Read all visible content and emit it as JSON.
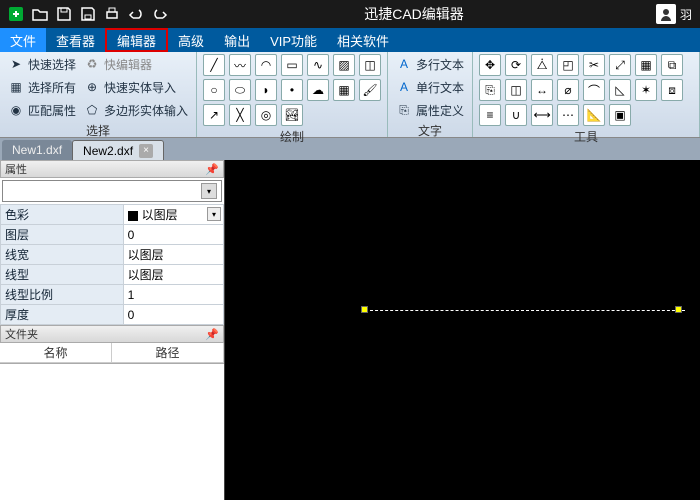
{
  "app_title": "迅捷CAD编辑器",
  "titlebar_right_user": "羽",
  "menu": {
    "file": "文件",
    "viewer": "查看器",
    "editor": "编辑器",
    "advanced": "高级",
    "output": "输出",
    "vip": "VIP功能",
    "related": "相关软件"
  },
  "ribbon": {
    "select": {
      "label": "选择",
      "quick_select": "快速选择",
      "quick_editor": "快编辑器",
      "select_all": "选择所有",
      "quick_entity_import": "快速实体导入",
      "match_props": "匹配属性",
      "polygon_entity_input": "多边形实体输入"
    },
    "draw": {
      "label": "绘制"
    },
    "text": {
      "label": "文字",
      "multi_text": "多行文本",
      "single_text": "单行文本",
      "attr_def": "属性定义"
    },
    "tools": {
      "label": "工具"
    }
  },
  "tabs": [
    {
      "name": "New1.dxf",
      "active": false
    },
    {
      "name": "New2.dxf",
      "active": true
    }
  ],
  "props_panel": {
    "header": "属性",
    "color_label": "色彩",
    "color_value": "以图层",
    "rows": [
      {
        "label": "图层",
        "value": "0"
      },
      {
        "label": "线宽",
        "value": "以图层"
      },
      {
        "label": "线型",
        "value": "以图层"
      },
      {
        "label": "线型比例",
        "value": "1"
      },
      {
        "label": "厚度",
        "value": "0"
      }
    ]
  },
  "folder_panel": {
    "header": "文件夹",
    "col_name": "名称",
    "col_path": "路径"
  }
}
